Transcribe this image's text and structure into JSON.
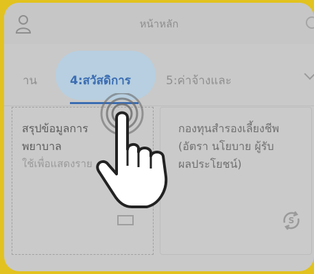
{
  "header": {
    "title": "หน้าหลัก",
    "icons": {
      "left": "user-icon",
      "right": "search-icon"
    }
  },
  "tabs": [
    {
      "label": "าน",
      "state": "inactive"
    },
    {
      "label": "4:สวัสดิการ",
      "state": "active"
    },
    {
      "label": "5:ค่าจ้างและ",
      "state": "inactive"
    }
  ],
  "cards": [
    {
      "title_line1": "สรุปข้อมูลการ",
      "title_line2": "พยาบาล",
      "subtitle": "ใช้เพื่อแสดงราย",
      "icon": "document-icon"
    },
    {
      "title_line1": "กองทุนสำรองเลี้ยงชีพ",
      "title_line2": "(อัตรา นโยบาย ผู้รับ",
      "title_line3": "ผลประโยชน์)",
      "icon": "refresh-icon"
    }
  ],
  "overlay": {
    "gesture": "tap-hand-icon"
  },
  "colors": {
    "frame_border": "#e2c21e",
    "active_tab": "#3b6db2",
    "active_pill": "#b7cfe0",
    "background": "#c9c9c9"
  }
}
